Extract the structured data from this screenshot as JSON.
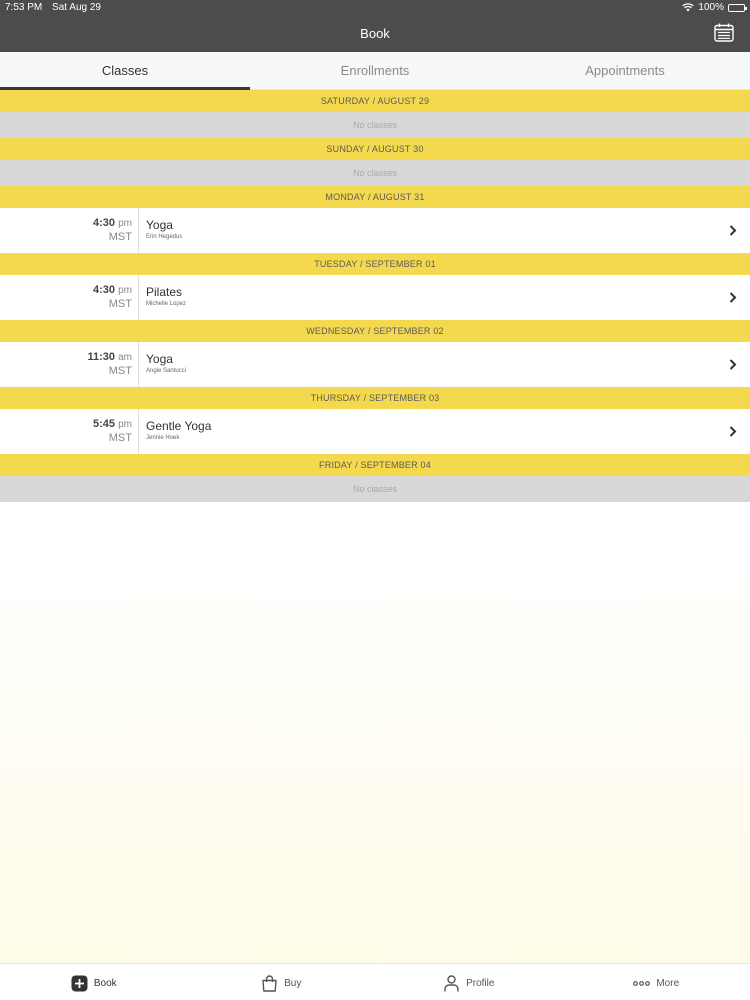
{
  "status_bar": {
    "time": "7:53 PM",
    "date": "Sat Aug 29",
    "battery": "100%"
  },
  "nav": {
    "title": "Book",
    "calendar_icon": "calendar-icon"
  },
  "tabs": [
    {
      "label": "Classes",
      "active": true
    },
    {
      "label": "Enrollments",
      "active": false
    },
    {
      "label": "Appointments",
      "active": false
    }
  ],
  "days": [
    {
      "header": "SATURDAY / AUGUST 29",
      "empty": "No classes"
    },
    {
      "header": "SUNDAY / AUGUST 30",
      "empty": "No classes"
    },
    {
      "header": "MONDAY / AUGUST 31",
      "class": {
        "time": "4:30",
        "ampm": "pm",
        "tz": "MST",
        "name": "Yoga",
        "instructor": "Erin Hegedus"
      }
    },
    {
      "header": "TUESDAY / SEPTEMBER 01",
      "class": {
        "time": "4:30",
        "ampm": "pm",
        "tz": "MST",
        "name": "Pilates",
        "instructor": "Michelle Lopez"
      }
    },
    {
      "header": "WEDNESDAY / SEPTEMBER 02",
      "class": {
        "time": "11:30",
        "ampm": "am",
        "tz": "MST",
        "name": "Yoga",
        "instructor": "Angie Santucci"
      }
    },
    {
      "header": "THURSDAY / SEPTEMBER 03",
      "class": {
        "time": "5:45",
        "ampm": "pm",
        "tz": "MST",
        "name": "Gentle Yoga",
        "instructor": "Jennie Hoek"
      }
    },
    {
      "header": "FRIDAY / SEPTEMBER 04",
      "empty": "No classes"
    }
  ],
  "bottom_nav": [
    {
      "label": "Book",
      "icon": "plus-square-icon",
      "active": true
    },
    {
      "label": "Buy",
      "icon": "shopping-bag-icon",
      "active": false
    },
    {
      "label": "Profile",
      "icon": "person-icon",
      "active": false
    },
    {
      "label": "More",
      "icon": "ellipsis-icon",
      "active": false
    }
  ],
  "colors": {
    "nav_bg": "#4c4c4c",
    "day_header": "#f4d94f",
    "no_classes_bg": "#d8d8d8"
  }
}
